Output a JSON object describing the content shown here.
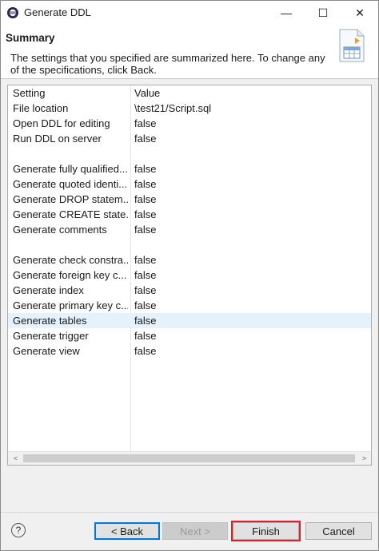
{
  "window": {
    "title": "Generate DDL",
    "minimize_glyph": "—",
    "maximize_glyph": "☐",
    "close_glyph": "✕"
  },
  "header": {
    "title": "Summary",
    "description": "The settings that you specified are summarized here. To change any of the specifications, click Back."
  },
  "table": {
    "columns": [
      "Setting",
      "Value"
    ],
    "rows": [
      {
        "setting": "File location",
        "value": "\\test21/Script.sql"
      },
      {
        "setting": "Open DDL for editing",
        "value": "false"
      },
      {
        "setting": "Run DDL on server",
        "value": "false"
      },
      {
        "setting": "",
        "value": ""
      },
      {
        "setting": "Generate fully qualified...",
        "value": "false"
      },
      {
        "setting": "Generate quoted identi...",
        "value": "false"
      },
      {
        "setting": "Generate DROP statem...",
        "value": "false"
      },
      {
        "setting": "Generate CREATE state...",
        "value": "false"
      },
      {
        "setting": "Generate comments",
        "value": "false"
      },
      {
        "setting": "",
        "value": ""
      },
      {
        "setting": "Generate check constra...",
        "value": "false"
      },
      {
        "setting": "Generate foreign key c...",
        "value": "false"
      },
      {
        "setting": "Generate index",
        "value": "false"
      },
      {
        "setting": "Generate primary key c...",
        "value": "false"
      },
      {
        "setting": "Generate tables",
        "value": "false"
      },
      {
        "setting": "Generate trigger",
        "value": "false"
      },
      {
        "setting": "Generate view",
        "value": "false"
      }
    ],
    "selected_row": "Generate tables",
    "scroll_left": "<",
    "scroll_right": ">"
  },
  "buttons": {
    "help": "?",
    "back": "< Back",
    "next": "Next >",
    "finish": "Finish",
    "cancel": "Cancel"
  },
  "colors": {
    "selection": "#e5f1fb",
    "focus_border": "#0078d7",
    "highlight_outline": "#e02020"
  }
}
